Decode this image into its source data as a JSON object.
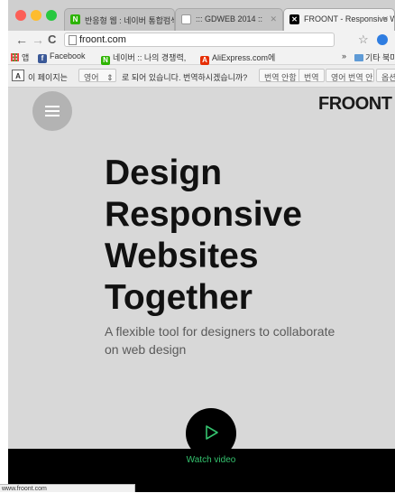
{
  "tabs": [
    {
      "title": "반응형 웹 : 네이버 통합검색",
      "favicon": "N",
      "favicon_color": "#2db400"
    },
    {
      "title": "::: GDWEB 2014 ::",
      "favicon": "",
      "favicon_color": "#ffffff"
    },
    {
      "title": "FROONT - Responsive W",
      "favicon": "",
      "favicon_color": "#000000"
    }
  ],
  "toolbar": {
    "url": "froont.com",
    "back": "←",
    "forward": "→",
    "reload": "C",
    "star": "☆"
  },
  "bookmarks": {
    "apps_label": "앱",
    "items": [
      {
        "label": "Facebook",
        "badge": "f",
        "color": "#3b5998"
      },
      {
        "label": "네이버 :: 나의 경쟁력, ",
        "badge": "N",
        "color": "#2db400"
      },
      {
        "label": "AliExpress.com에 ",
        "badge": "A",
        "color": "#e62e04"
      }
    ],
    "more": "»",
    "other": "기타 북마"
  },
  "translate_bar": {
    "prefix": "이 페이지는",
    "language": "영어",
    "suffix": "로 되어 있습니다. 번역하시겠습니까?",
    "no_translate": "번역 안함",
    "translate": "번역",
    "never_english": "영어 번역 안함",
    "options": "옵션"
  },
  "page": {
    "logo": "FROONT",
    "headline": [
      "Design",
      "Responsive",
      "Websites",
      "Together"
    ],
    "tagline": "A flexible tool for designers to collaborate on web design",
    "watch_video": "Watch video"
  },
  "status_bar": {
    "url": "www.froont.com"
  },
  "colors": {
    "accent": "#34c26e",
    "traffic_red": "#fc5f57",
    "traffic_yellow": "#fdbc2e",
    "traffic_green": "#28c840"
  }
}
